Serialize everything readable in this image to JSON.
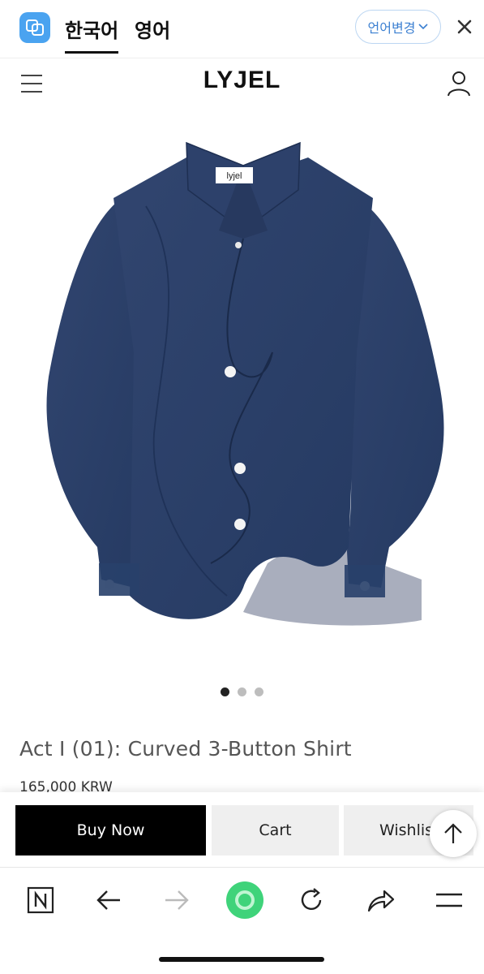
{
  "translate_bar": {
    "tab_korean": "한국어",
    "tab_english": "영어",
    "change_language_label": "언어변경"
  },
  "site_header": {
    "brand": "LYJEL"
  },
  "product": {
    "label_on_shirt": "lyjel",
    "title": "Act I (01): Curved 3-Button Shirt",
    "price": "165,000 KRW",
    "image_count": 3,
    "active_image": 1,
    "shirt_color": "#2c3f66"
  },
  "actions": {
    "buy_now": "Buy Now",
    "cart": "Cart",
    "wishlist": "Wishlis"
  },
  "browser": {
    "accent_color": "#3fd37a",
    "icons": [
      "naver-n-icon",
      "back-arrow-icon",
      "forward-arrow-icon",
      "green-home-icon",
      "reload-icon",
      "share-icon",
      "menu-icon"
    ]
  }
}
